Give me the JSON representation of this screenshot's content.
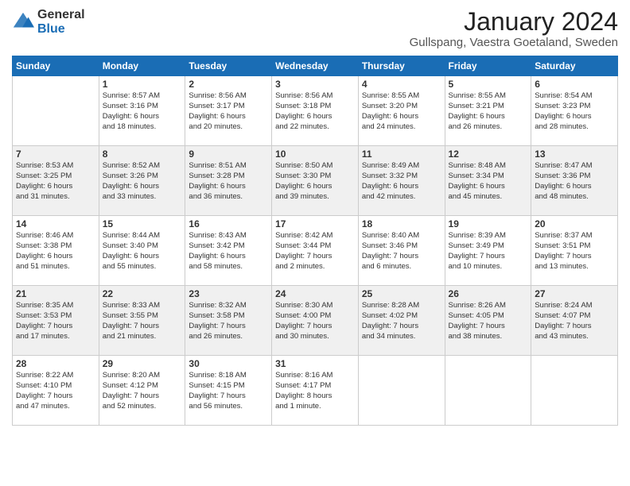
{
  "header": {
    "logo_general": "General",
    "logo_blue": "Blue",
    "month_title": "January 2024",
    "location": "Gullspang, Vaestra Goetaland, Sweden"
  },
  "days_of_week": [
    "Sunday",
    "Monday",
    "Tuesday",
    "Wednesday",
    "Thursday",
    "Friday",
    "Saturday"
  ],
  "weeks": [
    [
      {
        "day": "",
        "info": ""
      },
      {
        "day": "1",
        "info": "Sunrise: 8:57 AM\nSunset: 3:16 PM\nDaylight: 6 hours\nand 18 minutes."
      },
      {
        "day": "2",
        "info": "Sunrise: 8:56 AM\nSunset: 3:17 PM\nDaylight: 6 hours\nand 20 minutes."
      },
      {
        "day": "3",
        "info": "Sunrise: 8:56 AM\nSunset: 3:18 PM\nDaylight: 6 hours\nand 22 minutes."
      },
      {
        "day": "4",
        "info": "Sunrise: 8:55 AM\nSunset: 3:20 PM\nDaylight: 6 hours\nand 24 minutes."
      },
      {
        "day": "5",
        "info": "Sunrise: 8:55 AM\nSunset: 3:21 PM\nDaylight: 6 hours\nand 26 minutes."
      },
      {
        "day": "6",
        "info": "Sunrise: 8:54 AM\nSunset: 3:23 PM\nDaylight: 6 hours\nand 28 minutes."
      }
    ],
    [
      {
        "day": "7",
        "info": "Sunrise: 8:53 AM\nSunset: 3:25 PM\nDaylight: 6 hours\nand 31 minutes."
      },
      {
        "day": "8",
        "info": "Sunrise: 8:52 AM\nSunset: 3:26 PM\nDaylight: 6 hours\nand 33 minutes."
      },
      {
        "day": "9",
        "info": "Sunrise: 8:51 AM\nSunset: 3:28 PM\nDaylight: 6 hours\nand 36 minutes."
      },
      {
        "day": "10",
        "info": "Sunrise: 8:50 AM\nSunset: 3:30 PM\nDaylight: 6 hours\nand 39 minutes."
      },
      {
        "day": "11",
        "info": "Sunrise: 8:49 AM\nSunset: 3:32 PM\nDaylight: 6 hours\nand 42 minutes."
      },
      {
        "day": "12",
        "info": "Sunrise: 8:48 AM\nSunset: 3:34 PM\nDaylight: 6 hours\nand 45 minutes."
      },
      {
        "day": "13",
        "info": "Sunrise: 8:47 AM\nSunset: 3:36 PM\nDaylight: 6 hours\nand 48 minutes."
      }
    ],
    [
      {
        "day": "14",
        "info": "Sunrise: 8:46 AM\nSunset: 3:38 PM\nDaylight: 6 hours\nand 51 minutes."
      },
      {
        "day": "15",
        "info": "Sunrise: 8:44 AM\nSunset: 3:40 PM\nDaylight: 6 hours\nand 55 minutes."
      },
      {
        "day": "16",
        "info": "Sunrise: 8:43 AM\nSunset: 3:42 PM\nDaylight: 6 hours\nand 58 minutes."
      },
      {
        "day": "17",
        "info": "Sunrise: 8:42 AM\nSunset: 3:44 PM\nDaylight: 7 hours\nand 2 minutes."
      },
      {
        "day": "18",
        "info": "Sunrise: 8:40 AM\nSunset: 3:46 PM\nDaylight: 7 hours\nand 6 minutes."
      },
      {
        "day": "19",
        "info": "Sunrise: 8:39 AM\nSunset: 3:49 PM\nDaylight: 7 hours\nand 10 minutes."
      },
      {
        "day": "20",
        "info": "Sunrise: 8:37 AM\nSunset: 3:51 PM\nDaylight: 7 hours\nand 13 minutes."
      }
    ],
    [
      {
        "day": "21",
        "info": "Sunrise: 8:35 AM\nSunset: 3:53 PM\nDaylight: 7 hours\nand 17 minutes."
      },
      {
        "day": "22",
        "info": "Sunrise: 8:33 AM\nSunset: 3:55 PM\nDaylight: 7 hours\nand 21 minutes."
      },
      {
        "day": "23",
        "info": "Sunrise: 8:32 AM\nSunset: 3:58 PM\nDaylight: 7 hours\nand 26 minutes."
      },
      {
        "day": "24",
        "info": "Sunrise: 8:30 AM\nSunset: 4:00 PM\nDaylight: 7 hours\nand 30 minutes."
      },
      {
        "day": "25",
        "info": "Sunrise: 8:28 AM\nSunset: 4:02 PM\nDaylight: 7 hours\nand 34 minutes."
      },
      {
        "day": "26",
        "info": "Sunrise: 8:26 AM\nSunset: 4:05 PM\nDaylight: 7 hours\nand 38 minutes."
      },
      {
        "day": "27",
        "info": "Sunrise: 8:24 AM\nSunset: 4:07 PM\nDaylight: 7 hours\nand 43 minutes."
      }
    ],
    [
      {
        "day": "28",
        "info": "Sunrise: 8:22 AM\nSunset: 4:10 PM\nDaylight: 7 hours\nand 47 minutes."
      },
      {
        "day": "29",
        "info": "Sunrise: 8:20 AM\nSunset: 4:12 PM\nDaylight: 7 hours\nand 52 minutes."
      },
      {
        "day": "30",
        "info": "Sunrise: 8:18 AM\nSunset: 4:15 PM\nDaylight: 7 hours\nand 56 minutes."
      },
      {
        "day": "31",
        "info": "Sunrise: 8:16 AM\nSunset: 4:17 PM\nDaylight: 8 hours\nand 1 minute."
      },
      {
        "day": "",
        "info": ""
      },
      {
        "day": "",
        "info": ""
      },
      {
        "day": "",
        "info": ""
      }
    ]
  ]
}
